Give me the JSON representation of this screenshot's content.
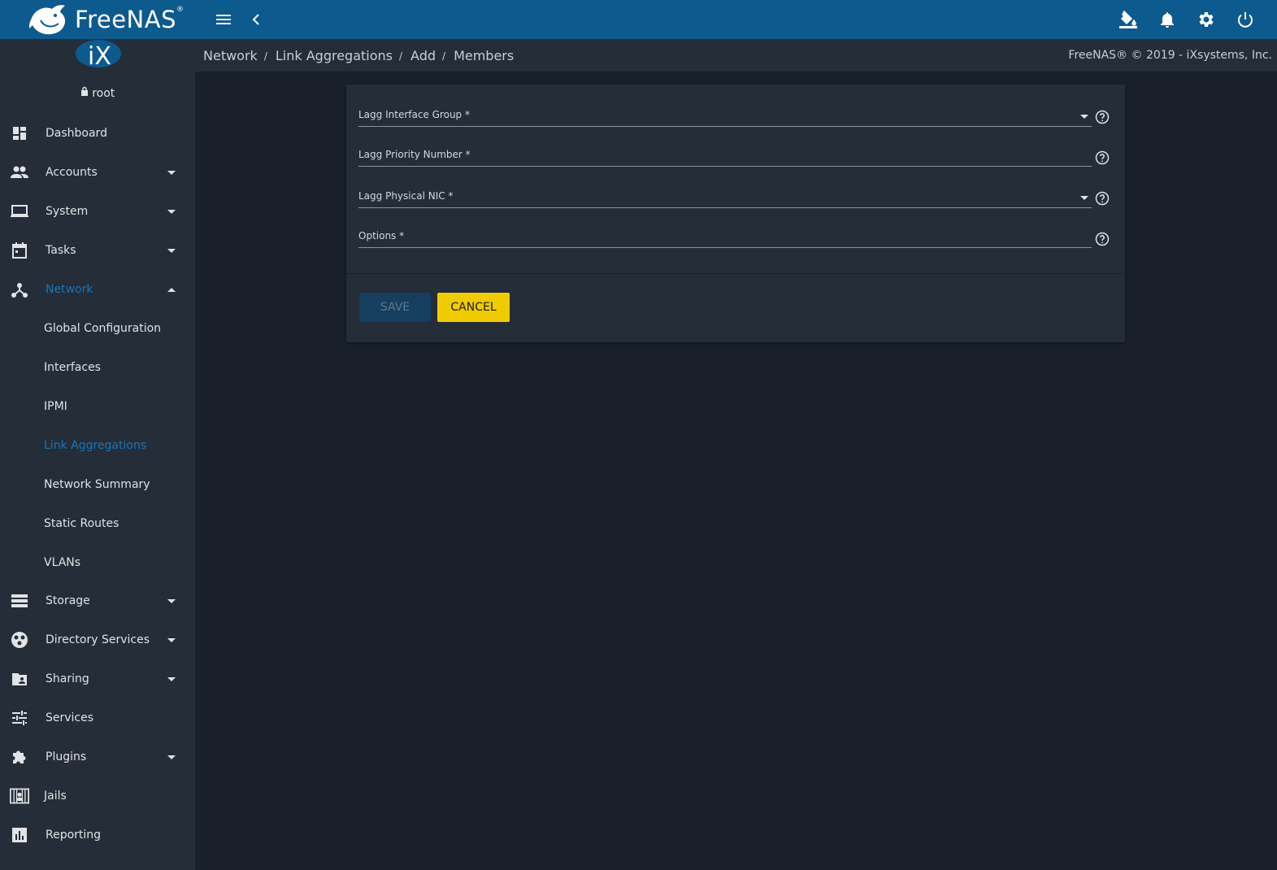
{
  "app": {
    "name": "FreeNAS",
    "trademark": "®"
  },
  "colors": {
    "topbar": "#0d5a8e",
    "accent": "#1b74b8",
    "cancel": "#f0cb00"
  },
  "user": {
    "name": "root",
    "icon": "lock-icon"
  },
  "sidebar": {
    "items": [
      {
        "label": "Dashboard",
        "icon": "dashboard-icon"
      },
      {
        "label": "Accounts",
        "icon": "people-icon"
      },
      {
        "label": "System",
        "icon": "laptop-icon"
      },
      {
        "label": "Tasks",
        "icon": "calendar-icon"
      },
      {
        "label": "Network",
        "icon": "network-icon"
      },
      {
        "label": "Storage",
        "icon": "storage-icon"
      },
      {
        "label": "Directory Services",
        "icon": "directory-icon"
      },
      {
        "label": "Sharing",
        "icon": "folder-shared-icon"
      },
      {
        "label": "Services",
        "icon": "tune-icon"
      },
      {
        "label": "Plugins",
        "icon": "puzzle-icon"
      },
      {
        "label": "Jails",
        "icon": "jail-icon"
      },
      {
        "label": "Reporting",
        "icon": "chart-icon"
      }
    ],
    "network_sub": [
      {
        "label": "Global Configuration"
      },
      {
        "label": "Interfaces"
      },
      {
        "label": "IPMI"
      },
      {
        "label": "Link Aggregations"
      },
      {
        "label": "Network Summary"
      },
      {
        "label": "Static Routes"
      },
      {
        "label": "VLANs"
      }
    ]
  },
  "breadcrumb": [
    "Network",
    "Link Aggregations",
    "Add",
    "Members"
  ],
  "copyright": "FreeNAS® © 2019 - iXsystems, Inc.",
  "form": {
    "fields": [
      {
        "label": "Lagg Interface Group  *",
        "type": "select"
      },
      {
        "label": "Lagg Priority Number  *",
        "type": "input"
      },
      {
        "label": "Lagg Physical NIC  *",
        "type": "select"
      },
      {
        "label": "Options  *",
        "type": "input"
      }
    ],
    "save_label": "SAVE",
    "cancel_label": "CANCEL"
  }
}
